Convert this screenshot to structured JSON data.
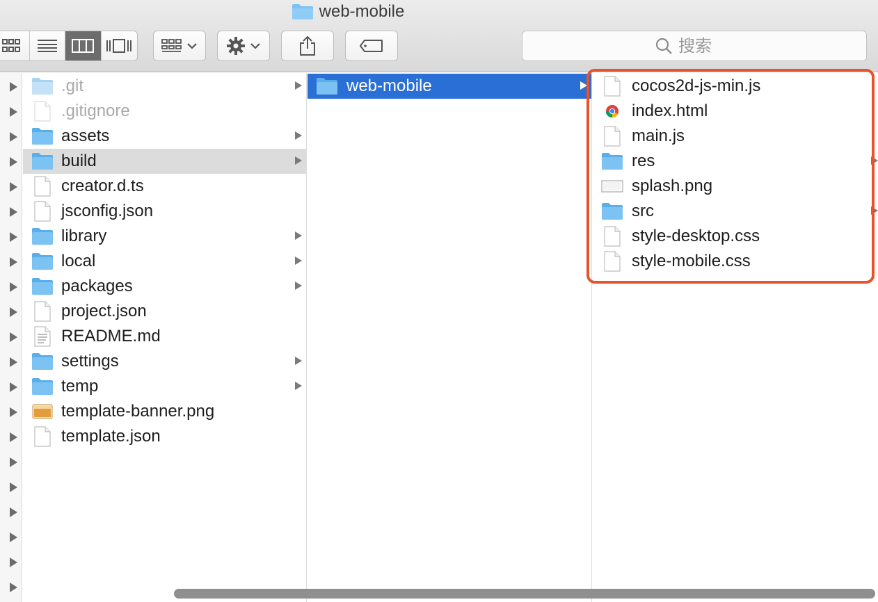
{
  "window": {
    "title": "web-mobile"
  },
  "toolbar": {
    "view_modes": [
      "icon-view",
      "list-view",
      "column-view",
      "cover-flow-view"
    ],
    "active_view": "column-view",
    "search": {
      "placeholder": "搜索"
    }
  },
  "columns": [
    {
      "items": [
        {
          "name": ".git",
          "kind": "folder",
          "dim": true,
          "arrow": true
        },
        {
          "name": ".gitignore",
          "kind": "file",
          "dim": true,
          "arrow": false
        },
        {
          "name": "assets",
          "kind": "folder",
          "dim": false,
          "arrow": true
        },
        {
          "name": "build",
          "kind": "folder",
          "dim": false,
          "arrow": true,
          "state": "highlighted"
        },
        {
          "name": "creator.d.ts",
          "kind": "file",
          "dim": false,
          "arrow": false
        },
        {
          "name": "jsconfig.json",
          "kind": "file",
          "dim": false,
          "arrow": false
        },
        {
          "name": "library",
          "kind": "folder",
          "dim": false,
          "arrow": true
        },
        {
          "name": "local",
          "kind": "folder",
          "dim": false,
          "arrow": true
        },
        {
          "name": "packages",
          "kind": "folder",
          "dim": false,
          "arrow": true
        },
        {
          "name": "project.json",
          "kind": "file",
          "dim": false,
          "arrow": false
        },
        {
          "name": "README.md",
          "kind": "text-file",
          "dim": false,
          "arrow": false
        },
        {
          "name": "settings",
          "kind": "folder",
          "dim": false,
          "arrow": true
        },
        {
          "name": "temp",
          "kind": "folder",
          "dim": false,
          "arrow": true
        },
        {
          "name": "template-banner.png",
          "kind": "image-banner",
          "dim": false,
          "arrow": false
        },
        {
          "name": "template.json",
          "kind": "file",
          "dim": false,
          "arrow": false
        }
      ]
    },
    {
      "items": [
        {
          "name": "web-mobile",
          "kind": "folder",
          "dim": false,
          "arrow": true,
          "state": "selected"
        }
      ]
    },
    {
      "items": [
        {
          "name": "cocos2d-js-min.js",
          "kind": "file",
          "dim": false,
          "arrow": false
        },
        {
          "name": "index.html",
          "kind": "chrome-html",
          "dim": false,
          "arrow": false
        },
        {
          "name": "main.js",
          "kind": "file",
          "dim": false,
          "arrow": false
        },
        {
          "name": "res",
          "kind": "folder",
          "dim": false,
          "arrow": true
        },
        {
          "name": "splash.png",
          "kind": "image-splash",
          "dim": false,
          "arrow": false
        },
        {
          "name": "src",
          "kind": "folder",
          "dim": false,
          "arrow": true
        },
        {
          "name": "style-desktop.css",
          "kind": "file",
          "dim": false,
          "arrow": false
        },
        {
          "name": "style-mobile.css",
          "kind": "file",
          "dim": false,
          "arrow": false
        }
      ]
    }
  ],
  "colors": {
    "selection": "#2a6fd6",
    "highlight_box": "#e6542d",
    "folder": "#6ab7ee"
  }
}
